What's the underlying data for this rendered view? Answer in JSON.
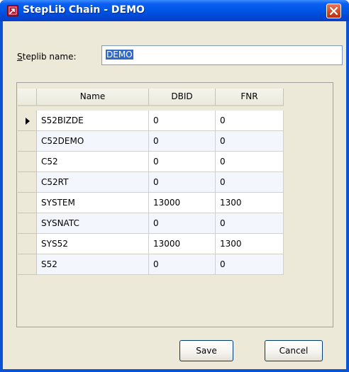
{
  "window": {
    "title": "StepLib Chain - DEMO"
  },
  "form": {
    "name_label": "Steplib name:",
    "name_mnemonic": "S",
    "name_rest": "teplib name:",
    "name_value": "DEMO"
  },
  "grid": {
    "columns": [
      "Name",
      "DBID",
      "FNR"
    ],
    "current_row_indicator": "arrow-right-icon",
    "rows": [
      {
        "name": "S52BIZDE",
        "dbid": "0",
        "fnr": "0"
      },
      {
        "name": "C52DEMO",
        "dbid": "0",
        "fnr": "0"
      },
      {
        "name": "C52",
        "dbid": "0",
        "fnr": "0"
      },
      {
        "name": "C52RT",
        "dbid": "0",
        "fnr": "0"
      },
      {
        "name": "SYSTEM",
        "dbid": "13000",
        "fnr": "1300"
      },
      {
        "name": "SYSNATC",
        "dbid": "0",
        "fnr": "0"
      },
      {
        "name": "SYS52",
        "dbid": "13000",
        "fnr": "1300"
      },
      {
        "name": "S52",
        "dbid": "0",
        "fnr": "0"
      }
    ]
  },
  "buttons": {
    "save": "Save",
    "cancel": "Cancel"
  },
  "colors": {
    "titlebar": "#0058e6",
    "client": "#ece9d8",
    "selection": "#316ac5",
    "close_button": "#d24722"
  }
}
